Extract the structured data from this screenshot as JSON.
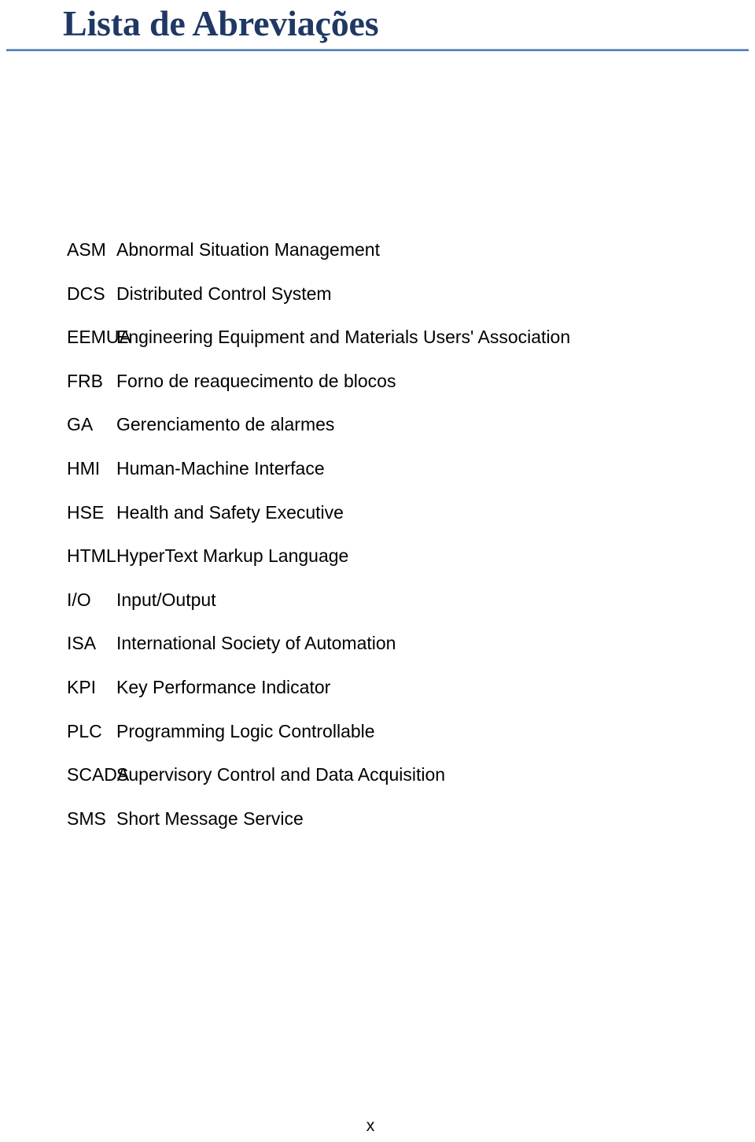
{
  "document": {
    "title": "Lista de Abreviações",
    "page_number": "x",
    "rule_color": "#4A7EBB",
    "title_color": "#1F3864"
  },
  "abbreviations": [
    {
      "term": "ASM",
      "definition": "Abnormal Situation Management"
    },
    {
      "term": "DCS",
      "definition": "Distributed Control System"
    },
    {
      "term": "EEMUA",
      "definition": "Engineering Equipment and Materials Users' Association"
    },
    {
      "term": "FRB",
      "definition": "Forno de reaquecimento de blocos"
    },
    {
      "term": "GA",
      "definition": "Gerenciamento de alarmes"
    },
    {
      "term": "HMI",
      "definition": "Human-Machine Interface"
    },
    {
      "term": "HSE",
      "definition": "Health and Safety Executive"
    },
    {
      "term": "HTML",
      "definition": "HyperText Markup Language"
    },
    {
      "term": "I/O",
      "definition": "Input/Output"
    },
    {
      "term": "ISA",
      "definition": "International Society of Automation"
    },
    {
      "term": "KPI",
      "definition": "Key Performance Indicator"
    },
    {
      "term": "PLC",
      "definition": "Programming Logic Controllable"
    },
    {
      "term": "SCADA",
      "definition": "Supervisory Control and Data Acquisition"
    },
    {
      "term": "SMS",
      "definition": "Short Message Service"
    }
  ]
}
